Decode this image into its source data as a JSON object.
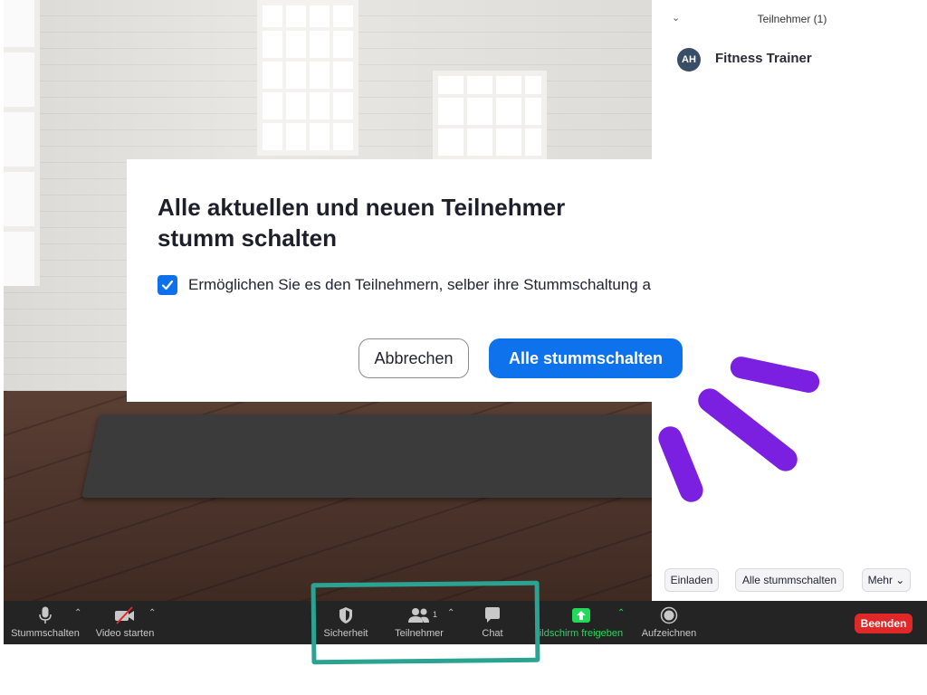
{
  "dialog": {
    "title": "Alle aktuellen und neuen Teilnehmer stumm schalten",
    "checkbox_label": "Ermöglichen Sie es den Teilnehmern, selber ihre Stummschaltung au",
    "checkbox_checked": true,
    "cancel_label": "Abbrechen",
    "confirm_label": "Alle stummschalten"
  },
  "participants_panel": {
    "title": "Teilnehmer (1)",
    "participants": [
      {
        "initials": "AH",
        "name": "Fitness Trainer"
      }
    ],
    "buttons": {
      "invite": "Einladen",
      "mute_all": "Alle stummschalten",
      "more": "Mehr"
    }
  },
  "toolbar": {
    "mute": "Stummschalten",
    "video": "Video starten",
    "security": "Sicherheit",
    "participants": "Teilnehmer",
    "participants_count": "1",
    "chat": "Chat",
    "share": "ildschirm freigeben",
    "record": "Aufzeichnen",
    "end": "Beenden"
  },
  "colors": {
    "primary_blue": "#0e72ed",
    "end_red": "#e02828",
    "share_green": "#23d959",
    "highlight_teal": "#2aa393",
    "accent_purple": "#7b1fe0"
  }
}
